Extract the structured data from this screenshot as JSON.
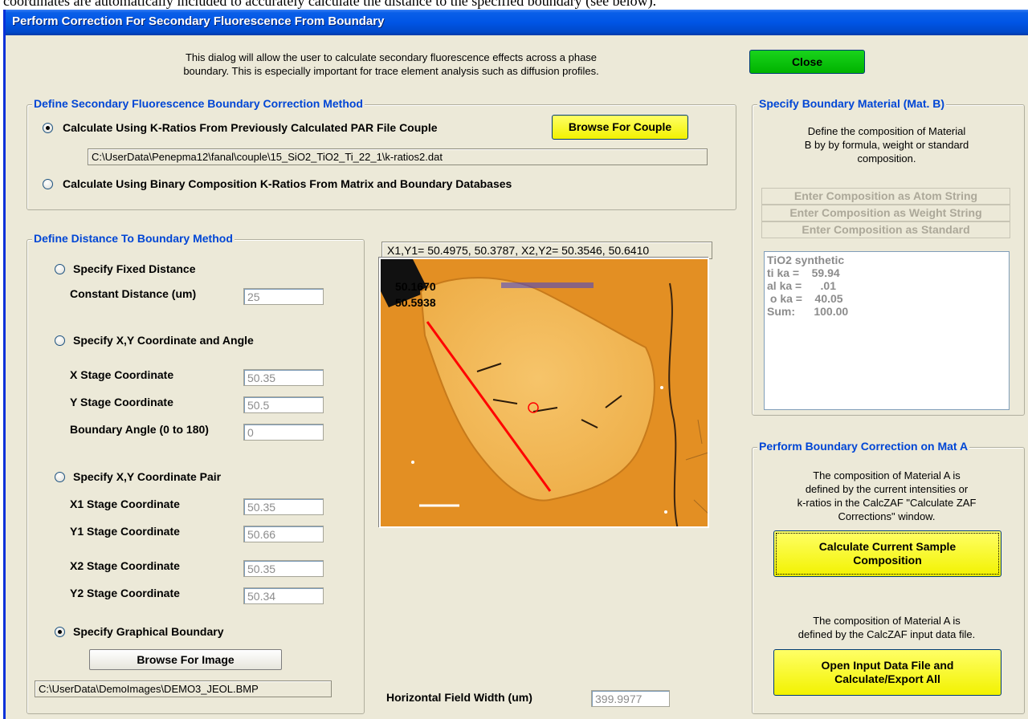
{
  "doc_text": "coordinates are automatically included to accurately calculate the distance to the specified boundary (see below).",
  "window_title": "Perform Correction For Secondary Fluorescence From Boundary",
  "intro": [
    "This dialog will allow the user to calculate secondary fluorescence effects across a phase",
    "boundary. This is especially important for trace element analysis such as diffusion profiles."
  ],
  "close_label": "Close",
  "method": {
    "legend": "Define Secondary Fluorescence Boundary Correction Method",
    "option1": "Calculate Using K-Ratios From Previously Calculated PAR File Couple",
    "browse_couple": "Browse For Couple",
    "couple_path": "C:\\UserData\\Penepma12\\fanal\\couple\\15_SiO2_TiO2_Ti_22_1\\k-ratios2.dat",
    "option2": "Calculate Using Binary Composition K-Ratios From Matrix and Boundary Databases",
    "selected": 1
  },
  "distance": {
    "legend": "Define Distance To Boundary Method",
    "fixed": {
      "label": "Specify Fixed Distance",
      "constant_label": "Constant Distance (um)",
      "constant_value": "25"
    },
    "xy_angle": {
      "label": "Specify X,Y Coordinate and Angle",
      "x_label": "X Stage Coordinate",
      "x_value": "50.35",
      "y_label": "Y Stage Coordinate",
      "y_value": "50.5",
      "angle_label": "Boundary Angle (0 to 180)",
      "angle_value": "0"
    },
    "pair": {
      "label": "Specify X,Y Coordinate Pair",
      "x1_label": "X1 Stage Coordinate",
      "x1_value": "50.35",
      "y1_label": "Y1 Stage Coordinate",
      "y1_value": "50.66",
      "x2_label": "X2 Stage Coordinate",
      "x2_value": "50.35",
      "y2_label": "Y2 Stage Coordinate",
      "y2_value": "50.34"
    },
    "graphical": {
      "label": "Specify Graphical Boundary",
      "browse_image": "Browse For Image",
      "image_path": "C:\\UserData\\DemoImages\\DEMO3_JEOL.BMP"
    },
    "selected": "graphical"
  },
  "image": {
    "coord_readout": "X1,Y1= 50.4975, 50.3787, X2,Y2= 50.3546, 50.6410",
    "overlay_x": "50.1670",
    "overlay_y": "50.5938",
    "hfw_label": "Horizontal Field Width (um)",
    "hfw_value": "399.9977"
  },
  "boundary_material": {
    "legend": "Specify Boundary Material (Mat. B)",
    "description": [
      "Define the composition of Material",
      "B by by formula, weight or standard",
      "composition."
    ],
    "btn_atom": "Enter Composition as Atom String",
    "btn_weight": "Enter Composition as Weight String",
    "btn_standard": "Enter Composition as Standard",
    "composition": [
      "TiO2 synthetic",
      "ti ka =    59.94",
      "al ka =      .01",
      " o ka =    40.05",
      "Sum:      100.00"
    ]
  },
  "correction": {
    "legend": "Perform Boundary Correction on Mat A",
    "desc1": [
      "The composition of Material A is",
      "defined by the current intensities or",
      "k-ratios in the CalcZAF \"Calculate ZAF",
      "Corrections\" window."
    ],
    "btn_calc": [
      "Calculate Current Sample",
      "Composition"
    ],
    "desc2": [
      "The composition of Material A is",
      "defined by the CalcZAF input data file."
    ],
    "btn_open": [
      "Open Input Data File and",
      "Calculate/Export All"
    ]
  },
  "colors": {
    "close_button": "#00b300",
    "action_button": "#ffff33",
    "legend_text": "#0046d5",
    "title_bar": "#0055e5",
    "image_background": "#e79a2c"
  }
}
